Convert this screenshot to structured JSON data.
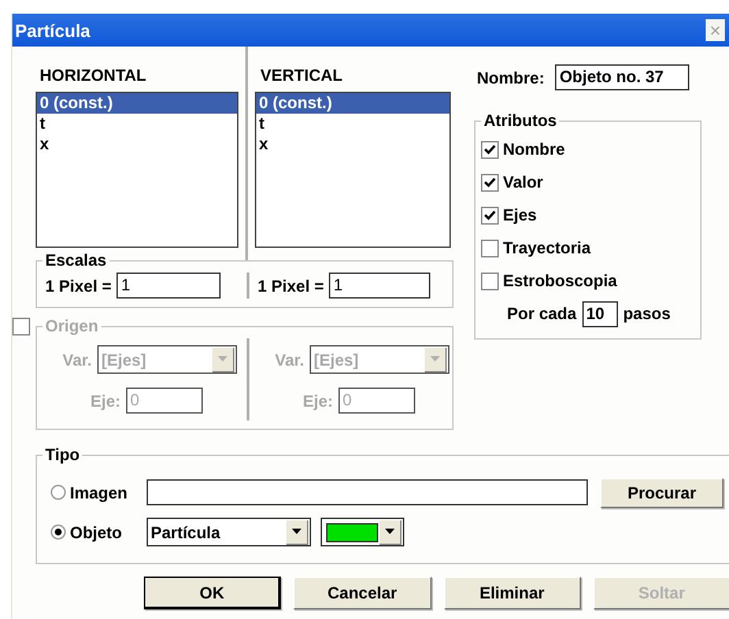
{
  "window": {
    "title": "Partícula",
    "close": "×"
  },
  "axes": [
    {
      "heading": "HORIZONTAL",
      "items": [
        {
          "label": "0 (const.)",
          "selected": true
        },
        {
          "label": "t",
          "selected": false
        },
        {
          "label": "x",
          "selected": false
        }
      ],
      "scale_label": "1 Pixel =",
      "scale_value": "1",
      "var_label": "Var.",
      "var_value": "[Ejes]",
      "eje_label": "Eje:",
      "eje_value": "0"
    },
    {
      "heading": "VERTICAL",
      "items": [
        {
          "label": "0 (const.)",
          "selected": true
        },
        {
          "label": "t",
          "selected": false
        },
        {
          "label": "x",
          "selected": false
        }
      ],
      "scale_label": "1 Pixel =",
      "scale_value": "1",
      "var_label": "Var.",
      "var_value": "[Ejes]",
      "eje_label": "Eje:",
      "eje_value": "0"
    }
  ],
  "escalas": {
    "title": "Escalas"
  },
  "origen": {
    "title": "Origen",
    "checked": false,
    "disabled": true
  },
  "nombre": {
    "label": "Nombre:",
    "value": "Objeto no. 37"
  },
  "atributos": {
    "title": "Atributos",
    "items": [
      {
        "label": "Nombre",
        "checked": true
      },
      {
        "label": "Valor",
        "checked": true
      },
      {
        "label": "Ejes",
        "checked": true
      },
      {
        "label": "Trayectoria",
        "checked": false
      },
      {
        "label": "Estroboscopia",
        "checked": false
      }
    ],
    "por_cada": {
      "label": "Por cada",
      "value": "10",
      "suffix": "pasos"
    }
  },
  "tipo": {
    "title": "Tipo",
    "options": [
      {
        "label": "Imagen",
        "selected": false,
        "kind": "file"
      },
      {
        "label": "Objeto",
        "selected": true,
        "kind": "object"
      }
    ],
    "browse_button": "Procurar",
    "object_value": "Partícula",
    "color": "#00e000"
  },
  "buttons": [
    {
      "label": "OK",
      "disabled": false,
      "default": true
    },
    {
      "label": "Cancelar",
      "disabled": false,
      "default": false
    },
    {
      "label": "Eliminar",
      "disabled": false,
      "default": false
    },
    {
      "label": "Soltar",
      "disabled": true,
      "default": false
    }
  ]
}
